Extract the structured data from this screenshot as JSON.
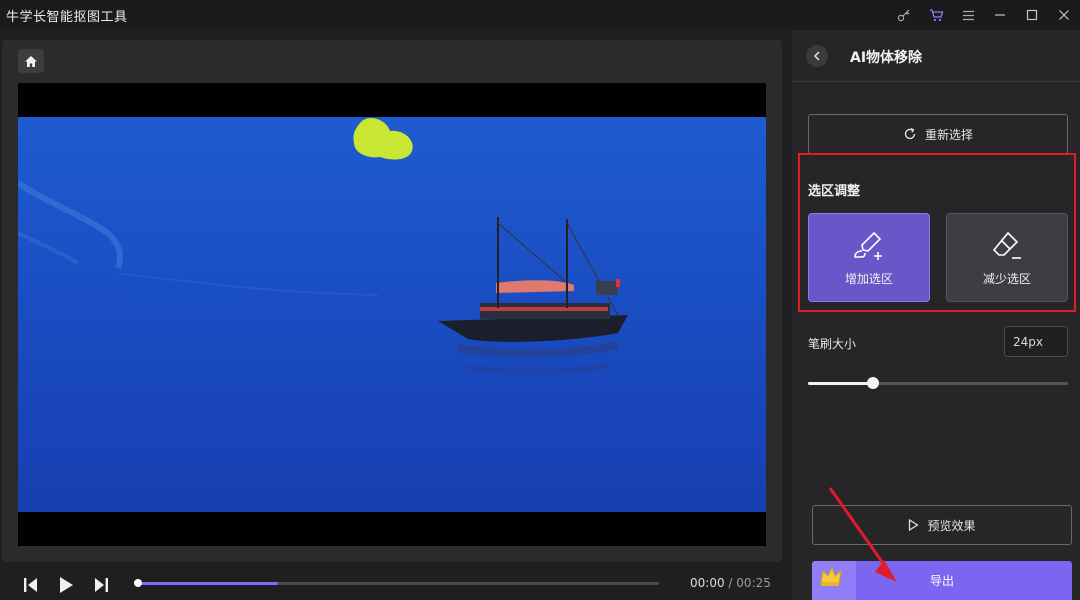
{
  "app": {
    "title": "牛学长智能抠图工具"
  },
  "titlebar": {
    "icons": [
      "key-icon",
      "cart-icon",
      "menu-icon",
      "minimize-icon",
      "maximize-icon",
      "close-icon"
    ]
  },
  "player": {
    "current_time": "00:00",
    "separator": "/",
    "total_time": "00:25",
    "progress_fraction": 0.27
  },
  "panel": {
    "title": "AI物体移除",
    "reselect_label": "重新选择",
    "section_title": "选区调整",
    "add_selection_label": "增加选区",
    "reduce_selection_label": "减少选区",
    "brush_size_label": "笔刷大小",
    "brush_size_value": "24px",
    "brush_size_fraction": 0.25,
    "preview_label": "预览效果",
    "export_label": "导出"
  },
  "colors": {
    "accent": "#7b66f2",
    "highlight_border": "#e21b2a",
    "sea": "#1c4fc4"
  }
}
